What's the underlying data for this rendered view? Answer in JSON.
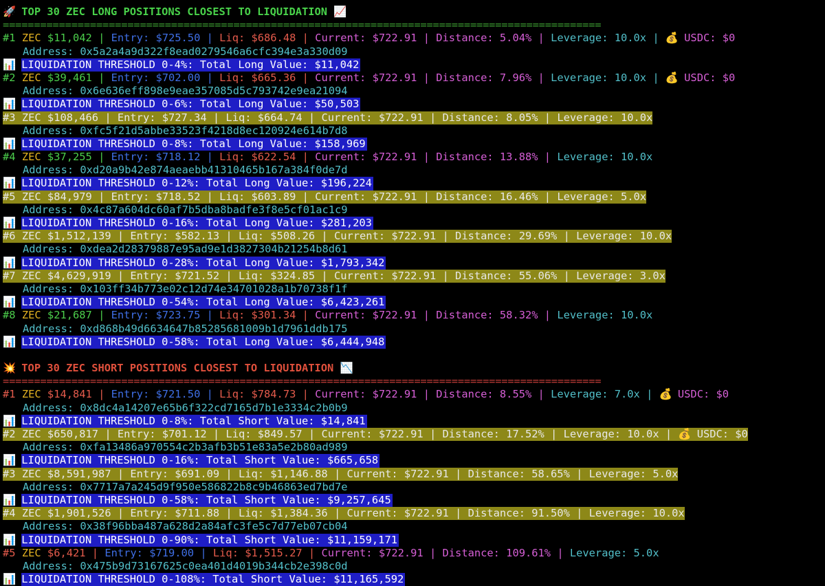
{
  "long_section": {
    "icon": "rocket-icon",
    "title": "TOP 30 ZEC LONG POSITIONS CLOSEST TO LIQUIDATION",
    "title_icon": "chart-up-icon",
    "separator": "================================================================================================",
    "positions": [
      {
        "rank": "#1",
        "asset": "ZEC",
        "value": "$11,042",
        "entry": "Entry: $725.50",
        "liq": "Liq: $686.48",
        "current": "Current: $722.91",
        "distance": "Distance: 5.04%",
        "leverage": "Leverage: 10.0x",
        "usdc": "USDC: $0",
        "address": "Address: 0x5a2a4a9d322f8ead0279546a6cfc394e3a330d09",
        "highlight": false,
        "threshold": "LIQUIDATION THRESHOLD 0-4%: Total Long Value: $11,042"
      },
      {
        "rank": "#2",
        "asset": "ZEC",
        "value": "$39,461",
        "entry": "Entry: $702.00",
        "liq": "Liq: $665.36",
        "current": "Current: $722.91",
        "distance": "Distance: 7.96%",
        "leverage": "Leverage: 10.0x",
        "usdc": "USDC: $0",
        "address": "Address: 0x6e636eff898e9eae357085d5c793742e9ea21094",
        "highlight": false,
        "threshold": "LIQUIDATION THRESHOLD 0-6%: Total Long Value: $50,503"
      },
      {
        "rank": "#3",
        "asset": "ZEC",
        "value": "$108,466",
        "entry": "Entry: $727.34",
        "liq": "Liq: $664.74",
        "current": "Current: $722.91",
        "distance": "Distance: 8.05%",
        "leverage": "Leverage: 10.0x",
        "usdc": "",
        "address": "Address: 0xfc5f21d5abbe33523f4218d8ec120924e614b7d8",
        "highlight": true,
        "threshold": "LIQUIDATION THRESHOLD 0-8%: Total Long Value: $158,969"
      },
      {
        "rank": "#4",
        "asset": "ZEC",
        "value": "$37,255",
        "entry": "Entry: $718.12",
        "liq": "Liq: $622.54",
        "current": "Current: $722.91",
        "distance": "Distance: 13.88%",
        "leverage": "Leverage: 10.0x",
        "usdc": "",
        "address": "Address: 0xd20a9b42e874aeaebb41310465b167a384f0de7d",
        "highlight": false,
        "threshold": "LIQUIDATION THRESHOLD 0-12%: Total Long Value: $196,224"
      },
      {
        "rank": "#5",
        "asset": "ZEC",
        "value": "$84,979",
        "entry": "Entry: $718.52",
        "liq": "Liq: $603.89",
        "current": "Current: $722.91",
        "distance": "Distance: 16.46%",
        "leverage": "Leverage: 5.0x",
        "usdc": "",
        "address": "Address: 0x4c87a604dc60af7b5dba8badfe3f8e5cf01ac1c9",
        "highlight": true,
        "threshold": "LIQUIDATION THRESHOLD 0-16%: Total Long Value: $281,203"
      },
      {
        "rank": "#6",
        "asset": "ZEC",
        "value": "$1,512,139",
        "entry": "Entry: $582.13",
        "liq": "Liq: $508.26",
        "current": "Current: $722.91",
        "distance": "Distance: 29.69%",
        "leverage": "Leverage: 10.0x",
        "usdc": "",
        "address": "Address: 0xdea2d28379887e95ad9e1d3827304b21254b8d61",
        "highlight": true,
        "threshold": "LIQUIDATION THRESHOLD 0-28%: Total Long Value: $1,793,342"
      },
      {
        "rank": "#7",
        "asset": "ZEC",
        "value": "$4,629,919",
        "entry": "Entry: $721.52",
        "liq": "Liq: $324.85",
        "current": "Current: $722.91",
        "distance": "Distance: 55.06%",
        "leverage": "Leverage: 3.0x",
        "usdc": "",
        "address": "Address: 0x103ff34b773e02c12d74e34701028a1b70738f1f",
        "highlight": true,
        "threshold": "LIQUIDATION THRESHOLD 0-54%: Total Long Value: $6,423,261"
      },
      {
        "rank": "#8",
        "asset": "ZEC",
        "value": "$21,687",
        "entry": "Entry: $723.75",
        "liq": "Liq: $301.34",
        "current": "Current: $722.91",
        "distance": "Distance: 58.32%",
        "leverage": "Leverage: 10.0x",
        "usdc": "",
        "address": "Address: 0xd868b49d6634647b85285681009b1d7961ddb175",
        "highlight": false,
        "threshold": "LIQUIDATION THRESHOLD 0-58%: Total Long Value: $6,444,948"
      }
    ]
  },
  "short_section": {
    "icon": "explosion-icon",
    "title": "TOP 30 ZEC SHORT POSITIONS CLOSEST TO LIQUIDATION",
    "title_icon": "chart-down-icon",
    "separator": "================================================================================================",
    "positions": [
      {
        "rank": "#1",
        "asset": "ZEC",
        "value": "$14,841",
        "entry": "Entry: $721.50",
        "liq": "Liq: $784.73",
        "current": "Current: $722.91",
        "distance": "Distance: 8.55%",
        "leverage": "Leverage: 7.0x",
        "usdc": "USDC: $0",
        "address": "Address: 0x8dc4a14207e65b6f322cd7165d7b1e3334c2b0b9",
        "highlight": false,
        "threshold": "LIQUIDATION THRESHOLD 0-8%: Total Short Value: $14,841"
      },
      {
        "rank": "#2",
        "asset": "ZEC",
        "value": "$650,817",
        "entry": "Entry: $701.12",
        "liq": "Liq: $849.57",
        "current": "Current: $722.91",
        "distance": "Distance: 17.52%",
        "leverage": "Leverage: 10.0x",
        "usdc": "USDC: $0",
        "address": "Address: 0xfa13486a970554c2b3afb3b51e83a5e2b80ad989",
        "highlight": true,
        "threshold": "LIQUIDATION THRESHOLD 0-16%: Total Short Value: $665,658"
      },
      {
        "rank": "#3",
        "asset": "ZEC",
        "value": "$8,591,987",
        "entry": "Entry: $691.09",
        "liq": "Liq: $1,146.88",
        "current": "Current: $722.91",
        "distance": "Distance: 58.65%",
        "leverage": "Leverage: 5.0x",
        "usdc": "",
        "address": "Address: 0x7717a7a245d9f950e586822b8c9b46863ed7bd7e",
        "highlight": true,
        "threshold": "LIQUIDATION THRESHOLD 0-58%: Total Short Value: $9,257,645"
      },
      {
        "rank": "#4",
        "asset": "ZEC",
        "value": "$1,901,526",
        "entry": "Entry: $711.88",
        "liq": "Liq: $1,384.36",
        "current": "Current: $722.91",
        "distance": "Distance: 91.50%",
        "leverage": "Leverage: 10.0x",
        "usdc": "",
        "address": "Address: 0x38f96bba487a628d2a84afc3fe5c7d77eb07cb04",
        "highlight": true,
        "threshold": "LIQUIDATION THRESHOLD 0-90%: Total Short Value: $11,159,171"
      },
      {
        "rank": "#5",
        "asset": "ZEC",
        "value": "$6,421",
        "entry": "Entry: $719.00",
        "liq": "Liq: $1,515.27",
        "current": "Current: $722.91",
        "distance": "Distance: 109.61%",
        "leverage": "Leverage: 5.0x",
        "usdc": "",
        "address": "Address: 0x475b9d73167625c0ea401d4019b344cb2e398c0d",
        "highlight": false,
        "threshold": "LIQUIDATION THRESHOLD 0-108%: Total Short Value: $11,165,592"
      }
    ]
  },
  "colors": {
    "background": "#000000",
    "long_header": "#49d24a",
    "short_header": "#e0503c",
    "threshold_bg": "#1f1ec6",
    "highlight_bg": "#8d8818"
  }
}
